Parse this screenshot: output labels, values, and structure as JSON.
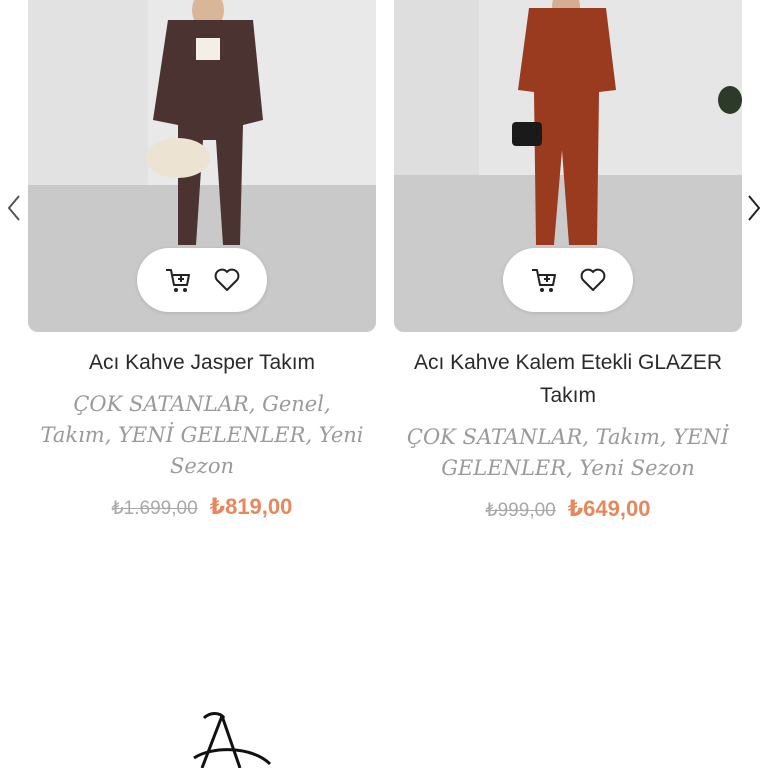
{
  "carousel": {
    "prev_icon": "chevron-left-icon",
    "next_icon": "chevron-right-icon"
  },
  "products": [
    {
      "title": "Acı Kahve Jasper Takım",
      "categories": "ÇOK SATANLAR, Genel, Takım, YENİ GELENLER, Yeni Sezon",
      "old_price": "₺1.699,00",
      "new_price": "₺819,00",
      "outfit_color": "#4a3330"
    },
    {
      "title": "Acı Kahve Kalem Etekli GLAZER Takım",
      "categories": "ÇOK SATANLAR, Takım, YENİ GELENLER, Yeni Sezon",
      "old_price": "₺999,00",
      "new_price": "₺649,00",
      "outfit_color": "#9a3a1e"
    }
  ],
  "colors": {
    "price_accent": "#e8875c",
    "muted_text": "#9a9a9a"
  }
}
